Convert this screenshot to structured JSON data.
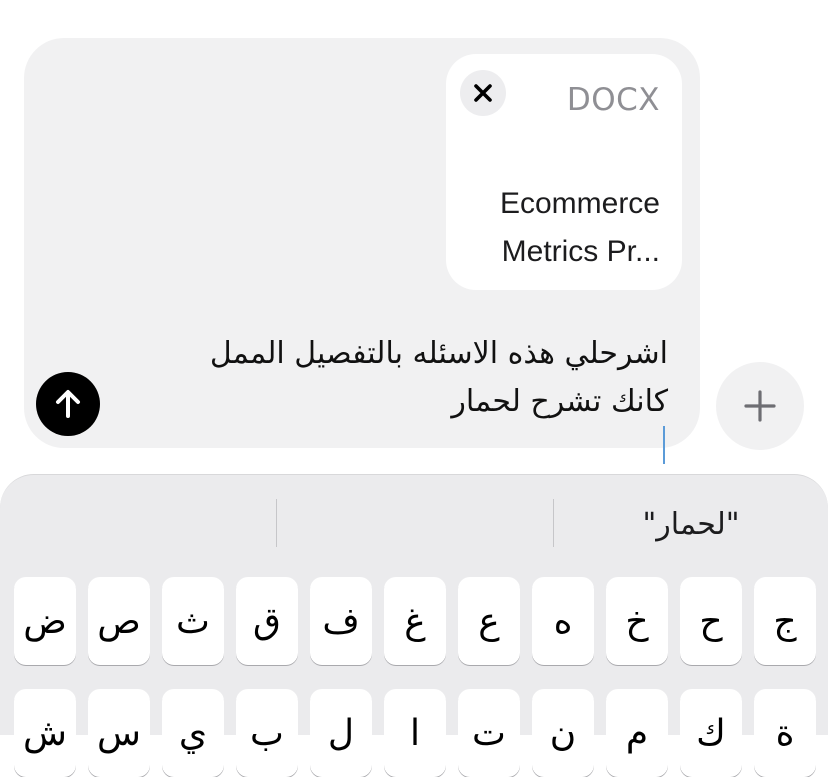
{
  "attachment": {
    "file_type": "DOCX",
    "file_name_line1": "Ecommerce",
    "file_name_line2": "Metrics Pr..."
  },
  "message": {
    "line1": "اشرحلي هذه الاسئله بالتفصيل الممل",
    "line2": "كانك تشرح لحمار"
  },
  "suggestions": {
    "left": "",
    "middle": "",
    "right": "\"لحمار\""
  },
  "keyboard": {
    "row1": [
      "ج",
      "ح",
      "خ",
      "ه",
      "ع",
      "غ",
      "ف",
      "ق",
      "ث",
      "ص",
      "ض"
    ],
    "row2": [
      "ة",
      "ك",
      "م",
      "ن",
      "ت",
      "ا",
      "ل",
      "ب",
      "ي",
      "س",
      "ش"
    ]
  },
  "icons": {
    "close": "x-icon",
    "send": "arrow-up-icon",
    "add": "plus-icon"
  },
  "colors": {
    "composer_bg": "#f1f1f2",
    "send_button": "#000000",
    "caret": "#5b9bd8",
    "keyboard_bg": "#ebebed"
  }
}
